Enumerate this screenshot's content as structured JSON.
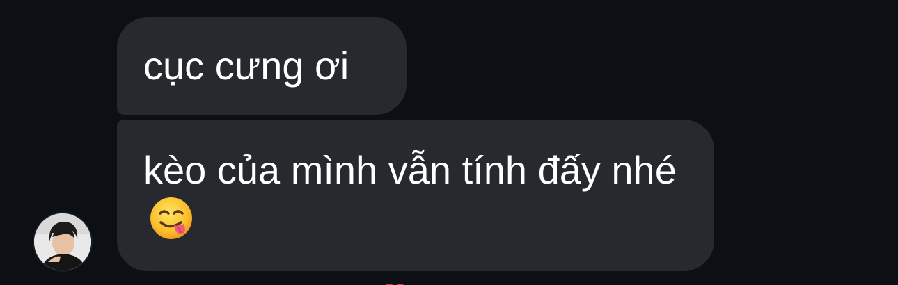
{
  "messages": [
    {
      "text": "cục cưng ơi"
    },
    {
      "text": "kèo của mình vẫn tính đấy nhé",
      "emoji": "face-savoring-food-emoji"
    }
  ],
  "avatar": {
    "icon": "user-avatar-photo"
  },
  "reaction": {
    "icon": "heart-reaction-icon",
    "color": "#e8334a"
  },
  "colors": {
    "background": "#0c1014",
    "bubble": "#262a2f",
    "text": "#ffffff"
  }
}
